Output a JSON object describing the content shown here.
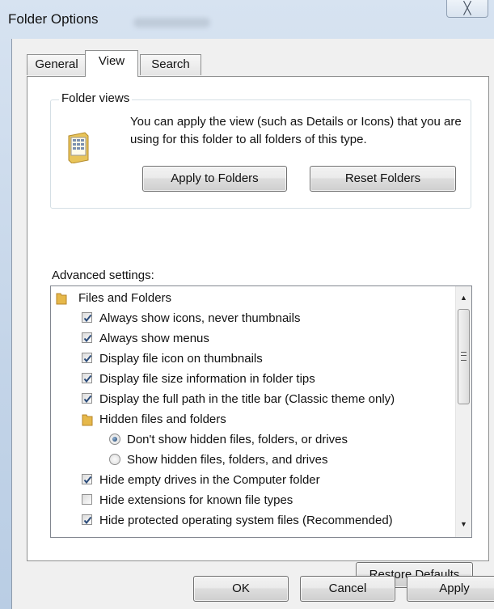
{
  "window": {
    "title": "Folder Options",
    "close_glyph": "╳"
  },
  "tabs": [
    {
      "label": "General",
      "active": false
    },
    {
      "label": "View",
      "active": true
    },
    {
      "label": "Search",
      "active": false
    }
  ],
  "folder_views": {
    "legend": "Folder views",
    "icon": "folder-view-icon",
    "description": "You can apply the view (such as Details or Icons) that you are using for this folder to all folders of this type.",
    "apply_button": "Apply to Folders",
    "reset_button": "Reset Folders"
  },
  "advanced": {
    "label": "Advanced settings:",
    "items": [
      {
        "type": "folder",
        "label": "Files and Folders"
      },
      {
        "type": "checkbox",
        "label": "Always show icons, never thumbnails",
        "checked": true
      },
      {
        "type": "checkbox",
        "label": "Always show menus",
        "checked": true
      },
      {
        "type": "checkbox",
        "label": "Display file icon on thumbnails",
        "checked": true
      },
      {
        "type": "checkbox",
        "label": "Display file size information in folder tips",
        "checked": true
      },
      {
        "type": "checkbox",
        "label": "Display the full path in the title bar (Classic theme only)",
        "checked": true
      },
      {
        "type": "folder",
        "label": "Hidden files and folders"
      },
      {
        "type": "radio",
        "label": "Don't show hidden files, folders, or drives",
        "selected": true
      },
      {
        "type": "radio",
        "label": "Show hidden files, folders, and drives",
        "selected": false
      },
      {
        "type": "checkbox",
        "label": "Hide empty drives in the Computer folder",
        "checked": true
      },
      {
        "type": "checkbox",
        "label": "Hide extensions for known file types",
        "checked": false
      },
      {
        "type": "checkbox",
        "label": "Hide protected operating system files (Recommended)",
        "checked": true
      }
    ]
  },
  "restore_button": "Restore Defaults",
  "footer": {
    "ok": "OK",
    "cancel": "Cancel",
    "apply": "Apply"
  }
}
